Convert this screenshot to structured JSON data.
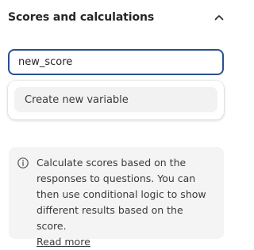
{
  "section": {
    "title": "Scores and calculations",
    "collapse_icon": "chevron-up-icon"
  },
  "variable_input": {
    "value": "new_score",
    "focused": true
  },
  "dropdown": {
    "items": [
      {
        "label": "Create new variable"
      }
    ]
  },
  "info": {
    "icon": "info-icon",
    "text": "Calculate scores based on the responses to questions. You can then use conditional logic to show different results based on the score.",
    "link_label": "Read more"
  },
  "colors": {
    "focus_border": "#2b4f8e",
    "info_background": "#f4f4f4",
    "item_highlight": "#f2f2f2",
    "text": "#262627"
  }
}
